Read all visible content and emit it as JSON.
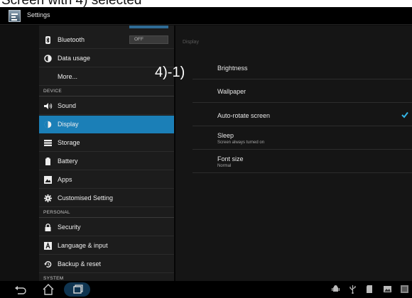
{
  "banner_text": "Screen with 4) selected",
  "app": {
    "title": "Settings",
    "icon": "settings-app-icon"
  },
  "sidebar": {
    "items": [
      {
        "label": "Bluetooth",
        "icon": "bluetooth-icon",
        "toggle": "OFF"
      },
      {
        "label": "Data usage",
        "icon": "data-usage-icon"
      },
      {
        "label": "More...",
        "icon": ""
      },
      {
        "header": "DEVICE"
      },
      {
        "label": "Sound",
        "icon": "speaker-icon"
      },
      {
        "label": "Display",
        "icon": "display-icon",
        "selected": true
      },
      {
        "label": "Storage",
        "icon": "storage-icon"
      },
      {
        "label": "Battery",
        "icon": "battery-icon"
      },
      {
        "label": "Apps",
        "icon": "apps-icon"
      },
      {
        "label": "Customised Setting",
        "icon": "gear-icon"
      },
      {
        "header": "PERSONAL"
      },
      {
        "label": "Security",
        "icon": "lock-icon"
      },
      {
        "label": "Language & input",
        "icon": "keyboard-icon"
      },
      {
        "label": "Backup & reset",
        "icon": "backup-icon"
      },
      {
        "header": "SYSTEM"
      }
    ]
  },
  "content": {
    "header": "Display",
    "rows": [
      {
        "title": "Brightness"
      },
      {
        "title": "Wallpaper"
      },
      {
        "title": "Auto-rotate screen",
        "checked": true
      },
      {
        "title": "Sleep",
        "subtitle": "Screen always turned on"
      },
      {
        "title": "Font size",
        "subtitle": "Normal"
      }
    ]
  },
  "annotation": "4)-1)",
  "navbar": {
    "buttons": [
      "back-icon",
      "home-icon",
      "recent-apps-icon"
    ],
    "tray_icons": [
      "android-icon",
      "usb-icon",
      "sd-card-icon",
      "screenshot-icon",
      "status-icon"
    ]
  },
  "colors": {
    "accent": "#1b7fb7",
    "checkmark": "#33b5e5"
  }
}
